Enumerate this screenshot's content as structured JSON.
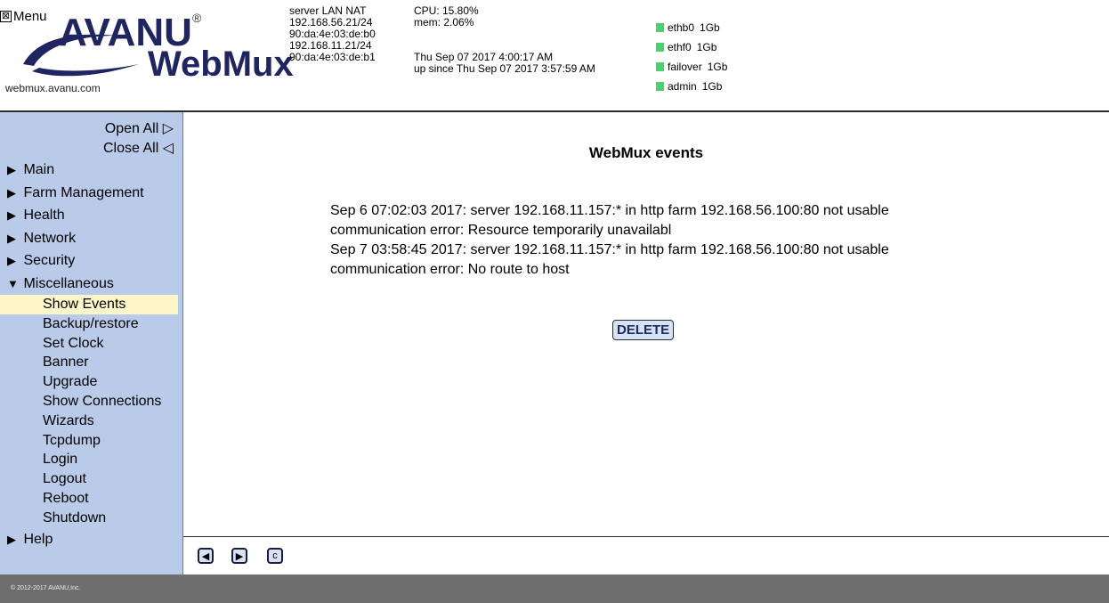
{
  "header": {
    "menu_label": "Menu",
    "menu_box": "⊠",
    "logo_top": "AVANU",
    "logo_reg": "®",
    "logo_bottom": "WebMux",
    "host": "webmux.avanu.com",
    "net": {
      "l1": "server LAN NAT",
      "l2": "192.168.56.21/24",
      "l3": "90:da:4e:03:de:b0",
      "l4": "192.168.11.21/24",
      "l5": "90:da:4e:03:de:b1"
    },
    "sys": {
      "cpu": "CPU: 15.80%",
      "mem": "mem: 2.06%",
      "time": "Thu Sep 07 2017 4:00:17 AM",
      "uptime": "up since Thu Sep 07 2017 3:57:59 AM"
    },
    "interfaces": [
      {
        "name": "ethb0",
        "speed": "1Gb"
      },
      {
        "name": "ethf0",
        "speed": "1Gb"
      },
      {
        "name": "failover",
        "speed": "1Gb"
      },
      {
        "name": "admin",
        "speed": "1Gb"
      }
    ],
    "status_color": "#47d26b"
  },
  "sidebar": {
    "open_all": "Open All ▷",
    "close_all": "Close All ◁",
    "collapsed_arrow": "▶",
    "expanded_arrow": "▼",
    "items": [
      {
        "label": "Main"
      },
      {
        "label": "Farm Management"
      },
      {
        "label": "Health"
      },
      {
        "label": "Network"
      },
      {
        "label": "Security"
      },
      {
        "label": "Miscellaneous"
      }
    ],
    "misc_sub": [
      {
        "label": "Show Events"
      },
      {
        "label": "Backup/restore"
      },
      {
        "label": "Set Clock"
      },
      {
        "label": "Banner"
      },
      {
        "label": "Upgrade"
      },
      {
        "label": "Show Connections"
      },
      {
        "label": "Wizards"
      },
      {
        "label": "Tcpdump"
      },
      {
        "label": "Login"
      },
      {
        "label": "Logout"
      },
      {
        "label": "Reboot"
      },
      {
        "label": "Shutdown"
      }
    ],
    "help": "Help"
  },
  "main": {
    "title": "WebMux events",
    "events": [
      "Sep 6 07:02:03 2017: server 192.168.11.157:* in http farm 192.168.56.100:80 not usable",
      "communication error: Resource temporarily unavailabl",
      "Sep 7 03:58:45 2017: server 192.168.11.157:* in http farm 192.168.56.100:80 not usable",
      "communication error: No route to host"
    ],
    "delete_label": "DELETE"
  },
  "navbar": {
    "back_icon": "◀",
    "forward_icon": "▶",
    "reload_icon": "c"
  },
  "footer": {
    "copyright": "© 2012-2017 AVANU,Inc."
  }
}
